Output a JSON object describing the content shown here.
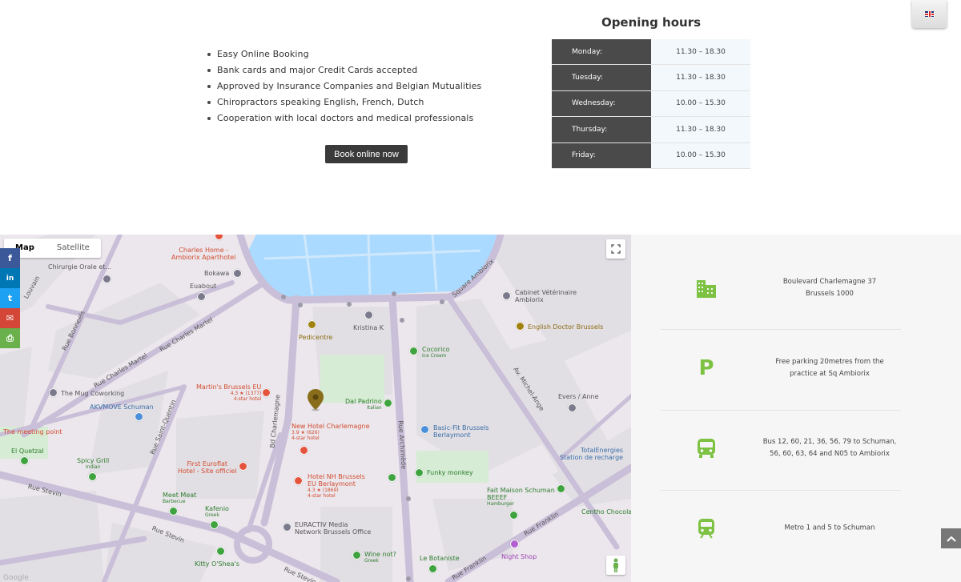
{
  "features": [
    "Easy Online Booking",
    "Bank cards and major Credit Cards accepted",
    "Approved by Insurance Companies and Belgian Mutualities",
    "Chiropractors speaking English, French, Dutch",
    "Cooperation with local doctors and medical professionals"
  ],
  "book_button": "Book online now",
  "opening_hours": {
    "title": "Opening hours",
    "rows": [
      {
        "day": "Monday:",
        "time": "11.30 – 18.30"
      },
      {
        "day": "Tuesday:",
        "time": "11.30 – 18.30"
      },
      {
        "day": "Wednesday:",
        "time": "10.00 – 15.30"
      },
      {
        "day": "Thursday:",
        "time": "11.30 – 18.30"
      },
      {
        "day": "Friday:",
        "time": "10.00 – 15.30"
      }
    ]
  },
  "language": {
    "icon": "uk-flag-icon"
  },
  "map": {
    "type_map": "Map",
    "type_satellite": "Satellite",
    "labels": {
      "charles_home": "Charles Home -",
      "charles_home2": "Ambiorix Aparthotel",
      "chirurgie": "Chirurgie Orale et...",
      "bokawa": "Bokawa",
      "euabout": "Euabout",
      "pedicentre": "Pedicentre",
      "kristina": "Kristina K",
      "cabinet1": "Cabinet Vétérinaire",
      "cabinet2": "Ambiorix",
      "english_doctor": "English Doctor Brussels",
      "cocorico": "Cocorico",
      "cocorico_sub": "Ice Cream",
      "martins1": "Martin's Brussels EU",
      "martins_rating": "4.3 ★ (1377)",
      "martins_sub": "4-star hotel",
      "mug": "The Mug Coworking",
      "akvmove": "AKVMOVE Schuman",
      "dal_padrino": "Dal Padrino",
      "dal_padrino_sub": "Italian",
      "new_hotel": "New Hotel Charlemagne",
      "new_hotel_rating": "3.9 ★ (626)",
      "new_hotel_sub": "4-star hotel",
      "evers": "Evers / Anne",
      "meeting": "The meeting point",
      "basic_fit1": "Basic-Fit Brussels",
      "basic_fit2": "Berlaymont",
      "el_quetzal": "El Quetzal",
      "spicy_grill": "Spicy Grill",
      "spicy_grill_sub": "Indian",
      "first_euroflat1": "First Euroflat",
      "first_euroflat2": "Hotel - Site officiel",
      "totalenergies1": "TotalEnergies",
      "totalenergies2": "Station de recharge",
      "funky": "Funky monkey",
      "nh1": "Hotel NH Brussels",
      "nh2": "EU Berlaymont",
      "nh_rating": "4.3 ★ (1869)",
      "nh_sub": "4-star hotel",
      "fait_maison1": "Fait Maison Schuman",
      "fait_maison2": "BEEEF",
      "fait_maison_sub": "Hamburger",
      "meet_meat": "Meet Meat",
      "meet_meat_sub": "Barbecue",
      "kafenio": "Kafenio",
      "kafenio_sub": "Greek",
      "centho": "Centho Chocola",
      "euractiv1": "EURACTIV Media",
      "euractiv2": "Network Brussels Office",
      "wine": "Wine not?",
      "wine_sub": "Greek",
      "night_shop": "Night Shop",
      "le_botaniste": "Le Botaniste",
      "kitty": "Kitty O'Shea's",
      "road_rue_bonneels": "Rue Bonneels",
      "road_charles_martel": "Rue Charles Martel",
      "road_square_ambiorix": "Square Ambiorix",
      "road_bd_charlemagne": "Bd Charlemagne",
      "road_archimede": "Rue Archimède",
      "road_michel_ange": "Av. Michel-Ange",
      "road_stevin": "Rue Stevin",
      "road_franklin": "Rue Franklin",
      "road_saint_quentin": "Rue Saint-Quentin",
      "road_louvain": "Louvain",
      "google": "Google"
    }
  },
  "social": [
    {
      "icon": "facebook-icon",
      "glyph": "f",
      "color": "#3b5998"
    },
    {
      "icon": "linkedin-icon",
      "glyph": "in",
      "color": "#0077b5"
    },
    {
      "icon": "twitter-icon",
      "glyph": "t",
      "color": "#1da1f2"
    },
    {
      "icon": "email-icon",
      "glyph": "✉",
      "color": "#d44638"
    },
    {
      "icon": "print-icon",
      "glyph": "⎙",
      "color": "#6ab04c"
    }
  ],
  "info": [
    {
      "icon": "building-icon",
      "lines": [
        "Boulevard Charlemagne 37",
        "Brussels 1000"
      ]
    },
    {
      "icon": "parking-icon",
      "glyph": "P",
      "lines": [
        "Free parking 20metres from the",
        "practice at Sq Ambiorix"
      ]
    },
    {
      "icon": "bus-icon",
      "lines": [
        "Bus 12, 60, 21, 36, 56, 79 to Schuman,",
        "56, 60, 63, 64 and N05 to Ambiorix"
      ]
    },
    {
      "icon": "metro-icon",
      "lines": [
        "Metro 1 and 5 to Schuman"
      ]
    }
  ],
  "colors": {
    "accent_green": "#7dc242",
    "dark": "#4a4a4a",
    "table_bg": "#f2f8fc"
  }
}
